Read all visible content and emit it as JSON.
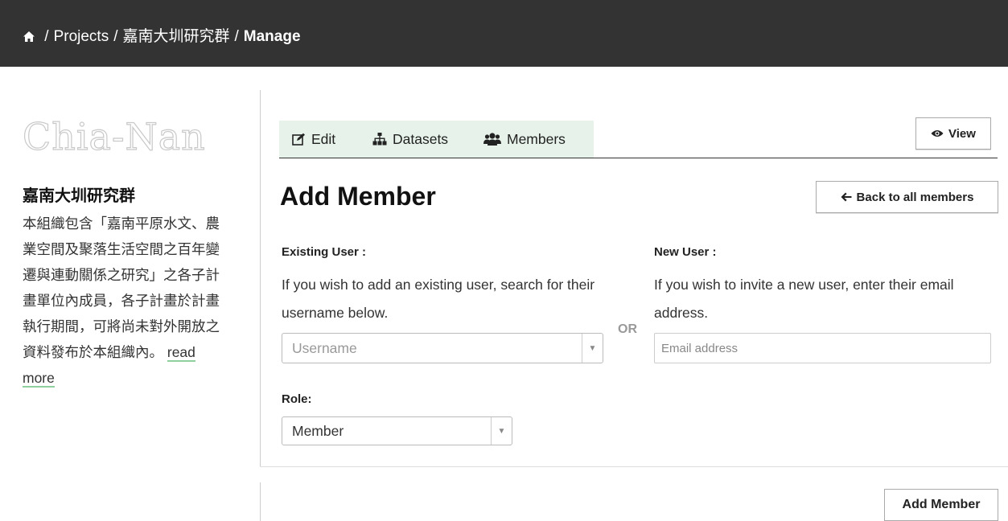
{
  "breadcrumb": {
    "projects": "Projects",
    "org": "嘉南大圳研究群",
    "current": "Manage",
    "separator": "/"
  },
  "sidebar": {
    "logo_text": "Chia-Nan",
    "org_title": "嘉南大圳研究群",
    "description": "本組織包含「嘉南平原水文、農業空間及聚落生活空間之百年變遷與連動關係之研究」之各子計畫單位內成員，各子計畫於計畫執行期間，可將尚未對外開放之資料發布於本組織內。",
    "read_more": "read more"
  },
  "tabs": {
    "edit": "Edit",
    "datasets": "Datasets",
    "members": "Members"
  },
  "buttons": {
    "view": "View",
    "back": "Back to all members",
    "add_member": "Add Member"
  },
  "page_title": "Add Member",
  "existing_user": {
    "label": "Existing User :",
    "help": "If you wish to add an existing user, search for their username below.",
    "placeholder": "Username"
  },
  "or_text": "OR",
  "new_user": {
    "label": "New User :",
    "help": "If you wish to invite a new user, enter their email address.",
    "placeholder": "Email address"
  },
  "role": {
    "label": "Role:",
    "selected": "Member"
  },
  "colors": {
    "topbar": "#333333",
    "tab_bg": "#e7f3ea",
    "link_underline": "#8fd19e"
  }
}
